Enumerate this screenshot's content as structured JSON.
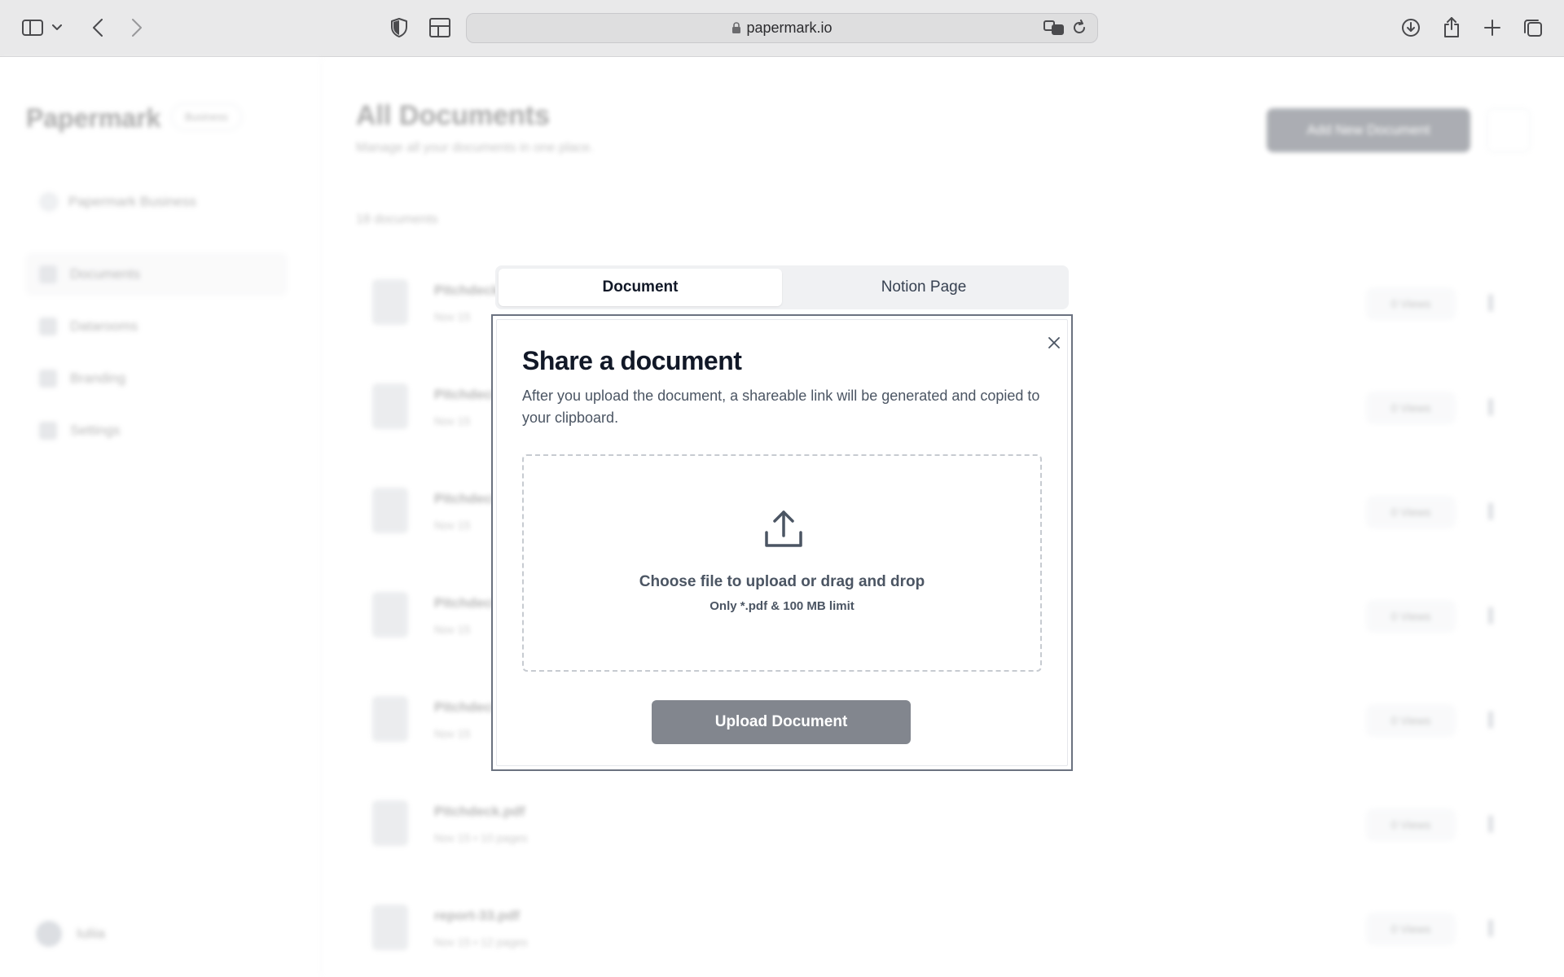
{
  "browser": {
    "url": "papermark.io"
  },
  "background": {
    "logo": "Papermark",
    "plan_badge": "Business",
    "team_name": "Papermark Business",
    "nav": [
      {
        "label": "Documents",
        "active": true
      },
      {
        "label": "Datarooms",
        "active": false
      },
      {
        "label": "Branding",
        "active": false
      },
      {
        "label": "Settings",
        "active": false
      }
    ],
    "user_name": "Iuliia",
    "page_title": "All Documents",
    "page_subtitle": "Manage all your documents in one place.",
    "add_button": "Add New Document",
    "doc_count": "18 documents",
    "rows": [
      {
        "name": "Pitchdeck",
        "meta": "Nov 15",
        "views": "0 Views"
      },
      {
        "name": "Pitchdeck",
        "meta": "Nov 15",
        "views": "0 Views"
      },
      {
        "name": "Pitchdeck",
        "meta": "Nov 15",
        "views": "0 Views"
      },
      {
        "name": "Pitchdeck",
        "meta": "Nov 15",
        "views": "0 Views"
      },
      {
        "name": "Pitchdeck",
        "meta": "Nov 15",
        "views": "0 Views"
      },
      {
        "name": "Pitchdeck.pdf",
        "meta": "Nov 15 • 10 pages",
        "views": "0 Views"
      },
      {
        "name": "report-33.pdf",
        "meta": "Nov 15 • 12 pages",
        "views": "0 Views"
      }
    ]
  },
  "modal": {
    "tabs": [
      {
        "label": "Document",
        "active": true
      },
      {
        "label": "Notion Page",
        "active": false
      }
    ],
    "title": "Share a document",
    "description": "After you upload the document, a shareable link will be generated and copied to your clipboard.",
    "dropzone_main": "Choose file to upload or drag and drop",
    "dropzone_sub": "Only *.pdf & 100 MB limit",
    "upload_button": "Upload Document"
  }
}
